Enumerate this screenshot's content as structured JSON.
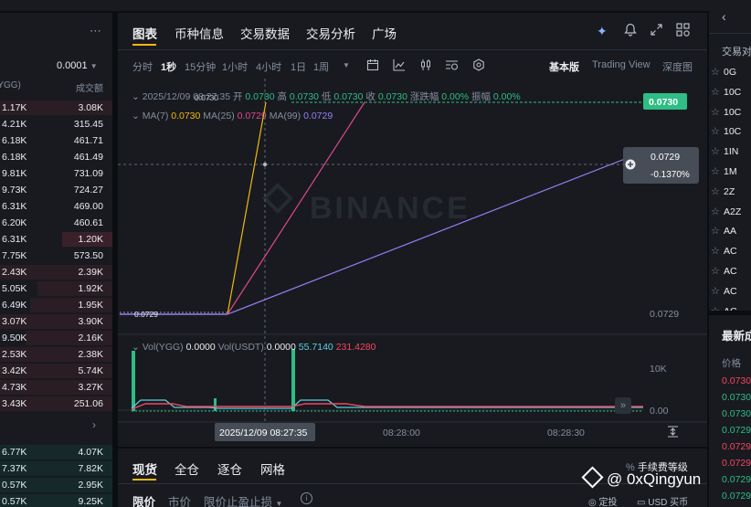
{
  "orderbook": {
    "tick_size": "0.0001",
    "col_qty_header": "(YGG)",
    "col_total_header": "成交额",
    "asks": [
      {
        "qty": "1.17K",
        "total": "3.08K"
      },
      {
        "qty": "4.21K",
        "total": "315.45"
      },
      {
        "qty": "6.18K",
        "total": "461.71"
      },
      {
        "qty": "6.18K",
        "total": "461.49"
      },
      {
        "qty": "9.81K",
        "total": "731.09"
      },
      {
        "qty": "9.73K",
        "total": "724.27"
      },
      {
        "qty": "6.31K",
        "total": "469.00"
      },
      {
        "qty": "6.20K",
        "total": "460.61"
      },
      {
        "qty": "6.31K",
        "total": "1.20K"
      },
      {
        "qty": "7.75K",
        "total": "573.50"
      },
      {
        "qty": "2.43K",
        "total": "2.39K"
      },
      {
        "qty": "5.05K",
        "total": "1.92K"
      },
      {
        "qty": "6.49K",
        "total": "1.95K"
      },
      {
        "qty": "3.07K",
        "total": "3.90K"
      },
      {
        "qty": "9.50K",
        "total": "2.16K"
      },
      {
        "qty": "2.53K",
        "total": "2.38K"
      },
      {
        "qty": "3.42K",
        "total": "5.74K"
      },
      {
        "qty": "4.73K",
        "total": "3.27K"
      },
      {
        "qty": "3.43K",
        "total": "251.06"
      }
    ],
    "bids": [
      {
        "qty": "6.77K",
        "total": "4.07K"
      },
      {
        "qty": "7.37K",
        "total": "7.82K"
      },
      {
        "qty": "0.57K",
        "total": "2.95K"
      },
      {
        "qty": "0.57K",
        "total": "9.25K"
      }
    ],
    "more_icon": "chevron-right-icon"
  },
  "chart": {
    "tabs": [
      "图表",
      "币种信息",
      "交易数据",
      "交易分析",
      "广场"
    ],
    "timeframes": [
      "分时",
      "1秒",
      "15分钟",
      "1小时",
      "4小时",
      "1日",
      "1周"
    ],
    "active_timeframe": "1秒",
    "views": [
      "基本版",
      "Trading View",
      "深度图"
    ],
    "active_view": "基本版",
    "ohlc": {
      "date": "2025/12/09 08:27:35",
      "open_label": "开",
      "open": "0.0730",
      "high_label": "高",
      "high": "0.0730",
      "low_label": "低",
      "low": "0.0730",
      "close_label": "收",
      "close": "0.0730",
      "change_label": "涨跌幅",
      "change": "0.00%",
      "amp_label": "振幅",
      "amp": "0.00%"
    },
    "ma": {
      "ma7_label": "MA(7)",
      "ma7": "0.0730",
      "ma25_label": "MA(25)",
      "ma25": "0.0729",
      "ma99_label": "MA(99)",
      "ma99": "0.0729"
    },
    "price_axis": {
      "last_price": "0.0730",
      "cursor_price": "0.0729",
      "cursor_change": "-0.1370%",
      "low_tick": "0.0729",
      "high_marker": "0.0730",
      "low_marker": "0.0729"
    },
    "volume": {
      "vol_base_label": "Vol(YGG)",
      "vol_base": "0.0000",
      "vol_quote_label": "Vol(USDT)",
      "vol_quote": "0.0000",
      "v1": "55.7140",
      "v2": "231.4280",
      "ticks": [
        "10K",
        "0.00"
      ]
    },
    "time_axis": {
      "cursor_time": "2025/12/09 08:27:35",
      "ticks": [
        "08:28:00",
        "08:28:30"
      ]
    },
    "watermark": "BINANCE",
    "colors": {
      "up": "#2ebd85",
      "down": "#f6465d",
      "ma7": "#f0b90b",
      "ma25": "#e2478f",
      "ma99": "#9b7cf5",
      "accent": "#f0b90b"
    }
  },
  "trade": {
    "tabs": [
      "现货",
      "全仓",
      "逐仓",
      "网格"
    ],
    "active_tab": "现货",
    "fee_label": "手续费等级",
    "order_types": [
      "限价",
      "市价",
      "限价止盈止损"
    ],
    "bottom_right": [
      "定投",
      "USD 买币"
    ]
  },
  "pairs": {
    "back_icon": "chevron-left-icon",
    "header": "交易对",
    "items": [
      "0G",
      "10C",
      "10C",
      "10C",
      "1IN",
      "1M",
      "2Z",
      "A2Z",
      "AA",
      "AC",
      "AC",
      "AC",
      "AC"
    ]
  },
  "latest": {
    "title": "最新成",
    "col_price": "价格",
    "prices": [
      {
        "p": "0.0730",
        "c": "red"
      },
      {
        "p": "0.0730",
        "c": "green"
      },
      {
        "p": "0.0730",
        "c": "green"
      },
      {
        "p": "0.0729",
        "c": "green"
      },
      {
        "p": "0.0729",
        "c": "red"
      },
      {
        "p": "0.0729",
        "c": "red"
      },
      {
        "p": "0.0729",
        "c": "green"
      },
      {
        "p": "0.0729",
        "c": "green"
      }
    ]
  },
  "watermark_user": "@ 0xQingyun"
}
